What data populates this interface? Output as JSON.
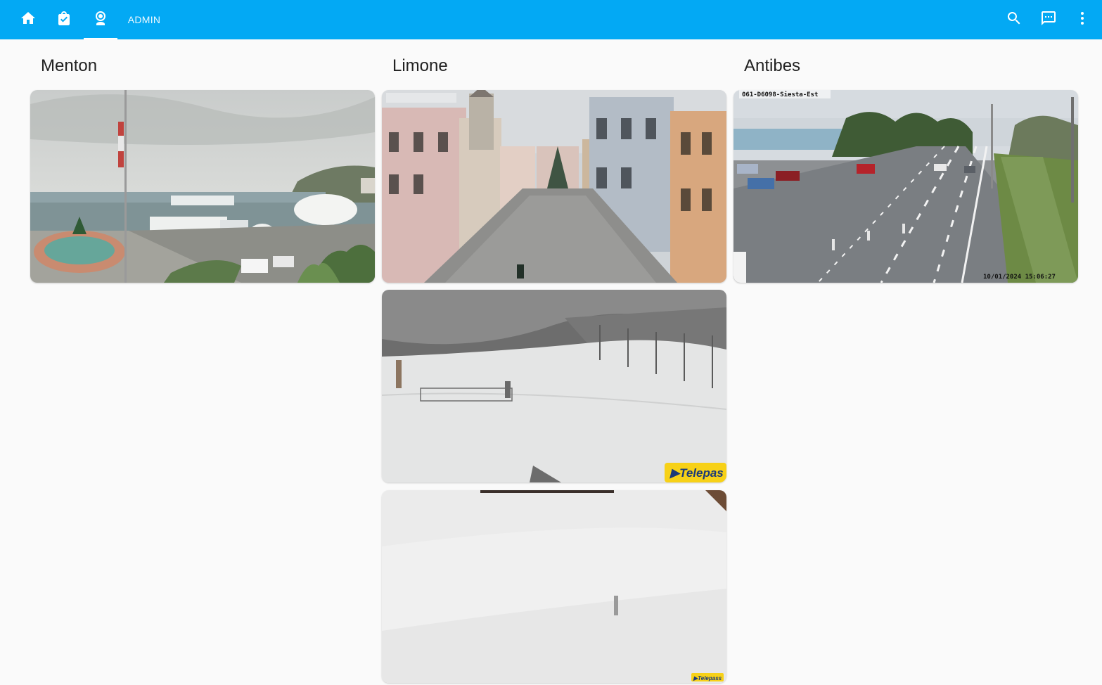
{
  "header": {
    "tabs": [
      {
        "icon": "home-icon"
      },
      {
        "icon": "shopping-bag-icon"
      },
      {
        "icon": "webcam-icon",
        "active": true
      }
    ],
    "admin_label": "ADMIN",
    "actions": [
      {
        "icon": "search-icon"
      },
      {
        "icon": "chat-icon"
      },
      {
        "icon": "more-vertical-icon"
      }
    ],
    "accent_color": "#03a9f4"
  },
  "columns": [
    {
      "title": "Menton",
      "cameras": [
        {
          "scene": "harbor marina with fountain and flag"
        }
      ]
    },
    {
      "title": "Limone",
      "cameras": [
        {
          "scene": "town square with snow",
          "overlay": ""
        },
        {
          "scene": "snowy ski slope with chairlift",
          "overlay": "Telepass"
        },
        {
          "scene": "foggy snow slope",
          "overlay": "Telepass"
        }
      ]
    },
    {
      "title": "Antibes",
      "cameras": [
        {
          "scene": "coastal road with traffic",
          "overlay_top": "061-D6098-Siesta-Est",
          "overlay_bottom": "10/01/2024 15:06:27"
        }
      ]
    }
  ]
}
